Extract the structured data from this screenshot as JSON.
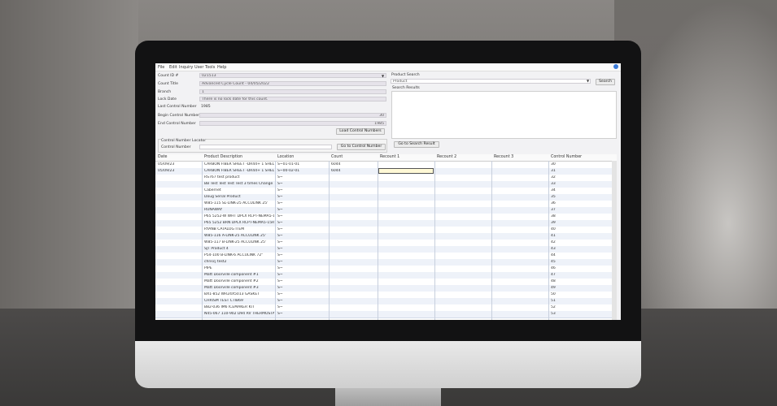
{
  "menu": [
    "File",
    "Edit",
    "Inquiry",
    "User Tools",
    "Help"
  ],
  "form": {
    "count_id_label": "Count ID #",
    "count_id_value": "021513",
    "count_title_label": "Count Title",
    "count_title_value": "Advanced Cycle Count - 04/05/2022",
    "branch_label": "Branch",
    "branch_value": "1",
    "lock_date_label": "Lock Date",
    "lock_date_value": "There is no lock date for this count.",
    "last_control_label": "Last Control Number",
    "last_control_value": "1985",
    "begin_control_label": "Begin Control Number",
    "begin_control_value": "30",
    "end_control_label": "End Control Number",
    "end_control_value": "1985",
    "load_button": "Load Control Numbers",
    "locator_title": "Control Number Locator",
    "control_number_label": "Control Number",
    "go_control_button": "Go to Control Number"
  },
  "search": {
    "title": "Product Search",
    "type_value": "Product",
    "search_button": "Search",
    "results_label": "Search Results",
    "go_result_button": "Go to Search Result"
  },
  "grid": {
    "headers": [
      "Date",
      "Product Description",
      "Location",
      "Count",
      "Recount 1",
      "Recount 2",
      "Recount 3",
      "Control Number"
    ],
    "rows": [
      [
        "05/09/23",
        "CARBON FIBER SHEET -DR44+ 1 SHEL",
        "S~01-01-01",
        "6044",
        "",
        "",
        "",
        "30"
      ],
      [
        "05/09/23",
        "CARBON FIBER SHEET -DR44+ 1 SHEL",
        "S~00-02-01",
        "6044",
        "",
        "",
        "",
        "31"
      ],
      [
        "",
        "RS767 test product",
        "S~",
        "",
        "",
        "",
        "",
        "32"
      ],
      [
        "",
        "BB Test Test Test Test 3 times Change it",
        "S~",
        "",
        "",
        "",
        "",
        "33"
      ],
      [
        "",
        "Cabernet",
        "S~",
        "",
        "",
        "",
        "",
        "34"
      ],
      [
        "",
        "Doug Serial Product",
        "S~",
        "",
        "",
        "",
        "",
        "35"
      ],
      [
        "",
        "W85-115 SL-LINK-25 ACCULINK 25'",
        "S~",
        "",
        "",
        "",
        "",
        "36"
      ],
      [
        "",
        "RUNAWAY",
        "S~",
        "",
        "",
        "",
        "",
        "37"
      ],
      [
        "",
        "P65 5252-W WHT DPLX RCPT-NEMA5-1",
        "S~",
        "",
        "",
        "",
        "",
        "38"
      ],
      [
        "",
        "P65 5252 BRN DPLX RCPT-NEMA5-15R",
        "S~",
        "",
        "",
        "",
        "",
        "39"
      ],
      [
        "",
        "RYANB CATALOG ITEM",
        "S~",
        "",
        "",
        "",
        "",
        "40"
      ],
      [
        "",
        "W85-116 A-LINK-25 ACCULINK 25'",
        "S~",
        "",
        "",
        "",
        "",
        "41"
      ],
      [
        "",
        "W85-117 B-LINK-25 ACCULINK 25'",
        "S~",
        "",
        "",
        "",
        "",
        "42"
      ],
      [
        "",
        "SJT Product 4",
        "S~",
        "",
        "",
        "",
        "",
        "43"
      ],
      [
        "",
        "P54-100 B-LINK-6 ACCULINK 72\"",
        "S~",
        "",
        "",
        "",
        "",
        "44"
      ],
      [
        "",
        "chriscj test2",
        "S~",
        "",
        "",
        "",
        "",
        "45"
      ],
      [
        "",
        "PIPE",
        "S~",
        "",
        "",
        "",
        "",
        "46"
      ],
      [
        "",
        "Matt Doorville component #1",
        "S~",
        "",
        "",
        "",
        "",
        "47"
      ],
      [
        "",
        "Matt Doorville component #2",
        "S~",
        "",
        "",
        "",
        "",
        "48"
      ],
      [
        "",
        "Matt Doorville component #3",
        "S~",
        "",
        "",
        "",
        "",
        "49"
      ],
      [
        "",
        "BX1-852 WR24X5013 GASKET",
        "S~",
        "",
        "",
        "",
        "",
        "50"
      ],
      [
        "",
        "CHRISM TEST CTIB69",
        "S~",
        "",
        "",
        "",
        "",
        "51"
      ],
      [
        "",
        "B82-036 IM6 ICEMAKER KIT",
        "S~",
        "",
        "",
        "",
        "",
        "52"
      ],
      [
        "",
        "N45-067 110-902 D94 RV THERMOSTAT",
        "S~",
        "",
        "",
        "",
        "",
        "53"
      ]
    ]
  }
}
